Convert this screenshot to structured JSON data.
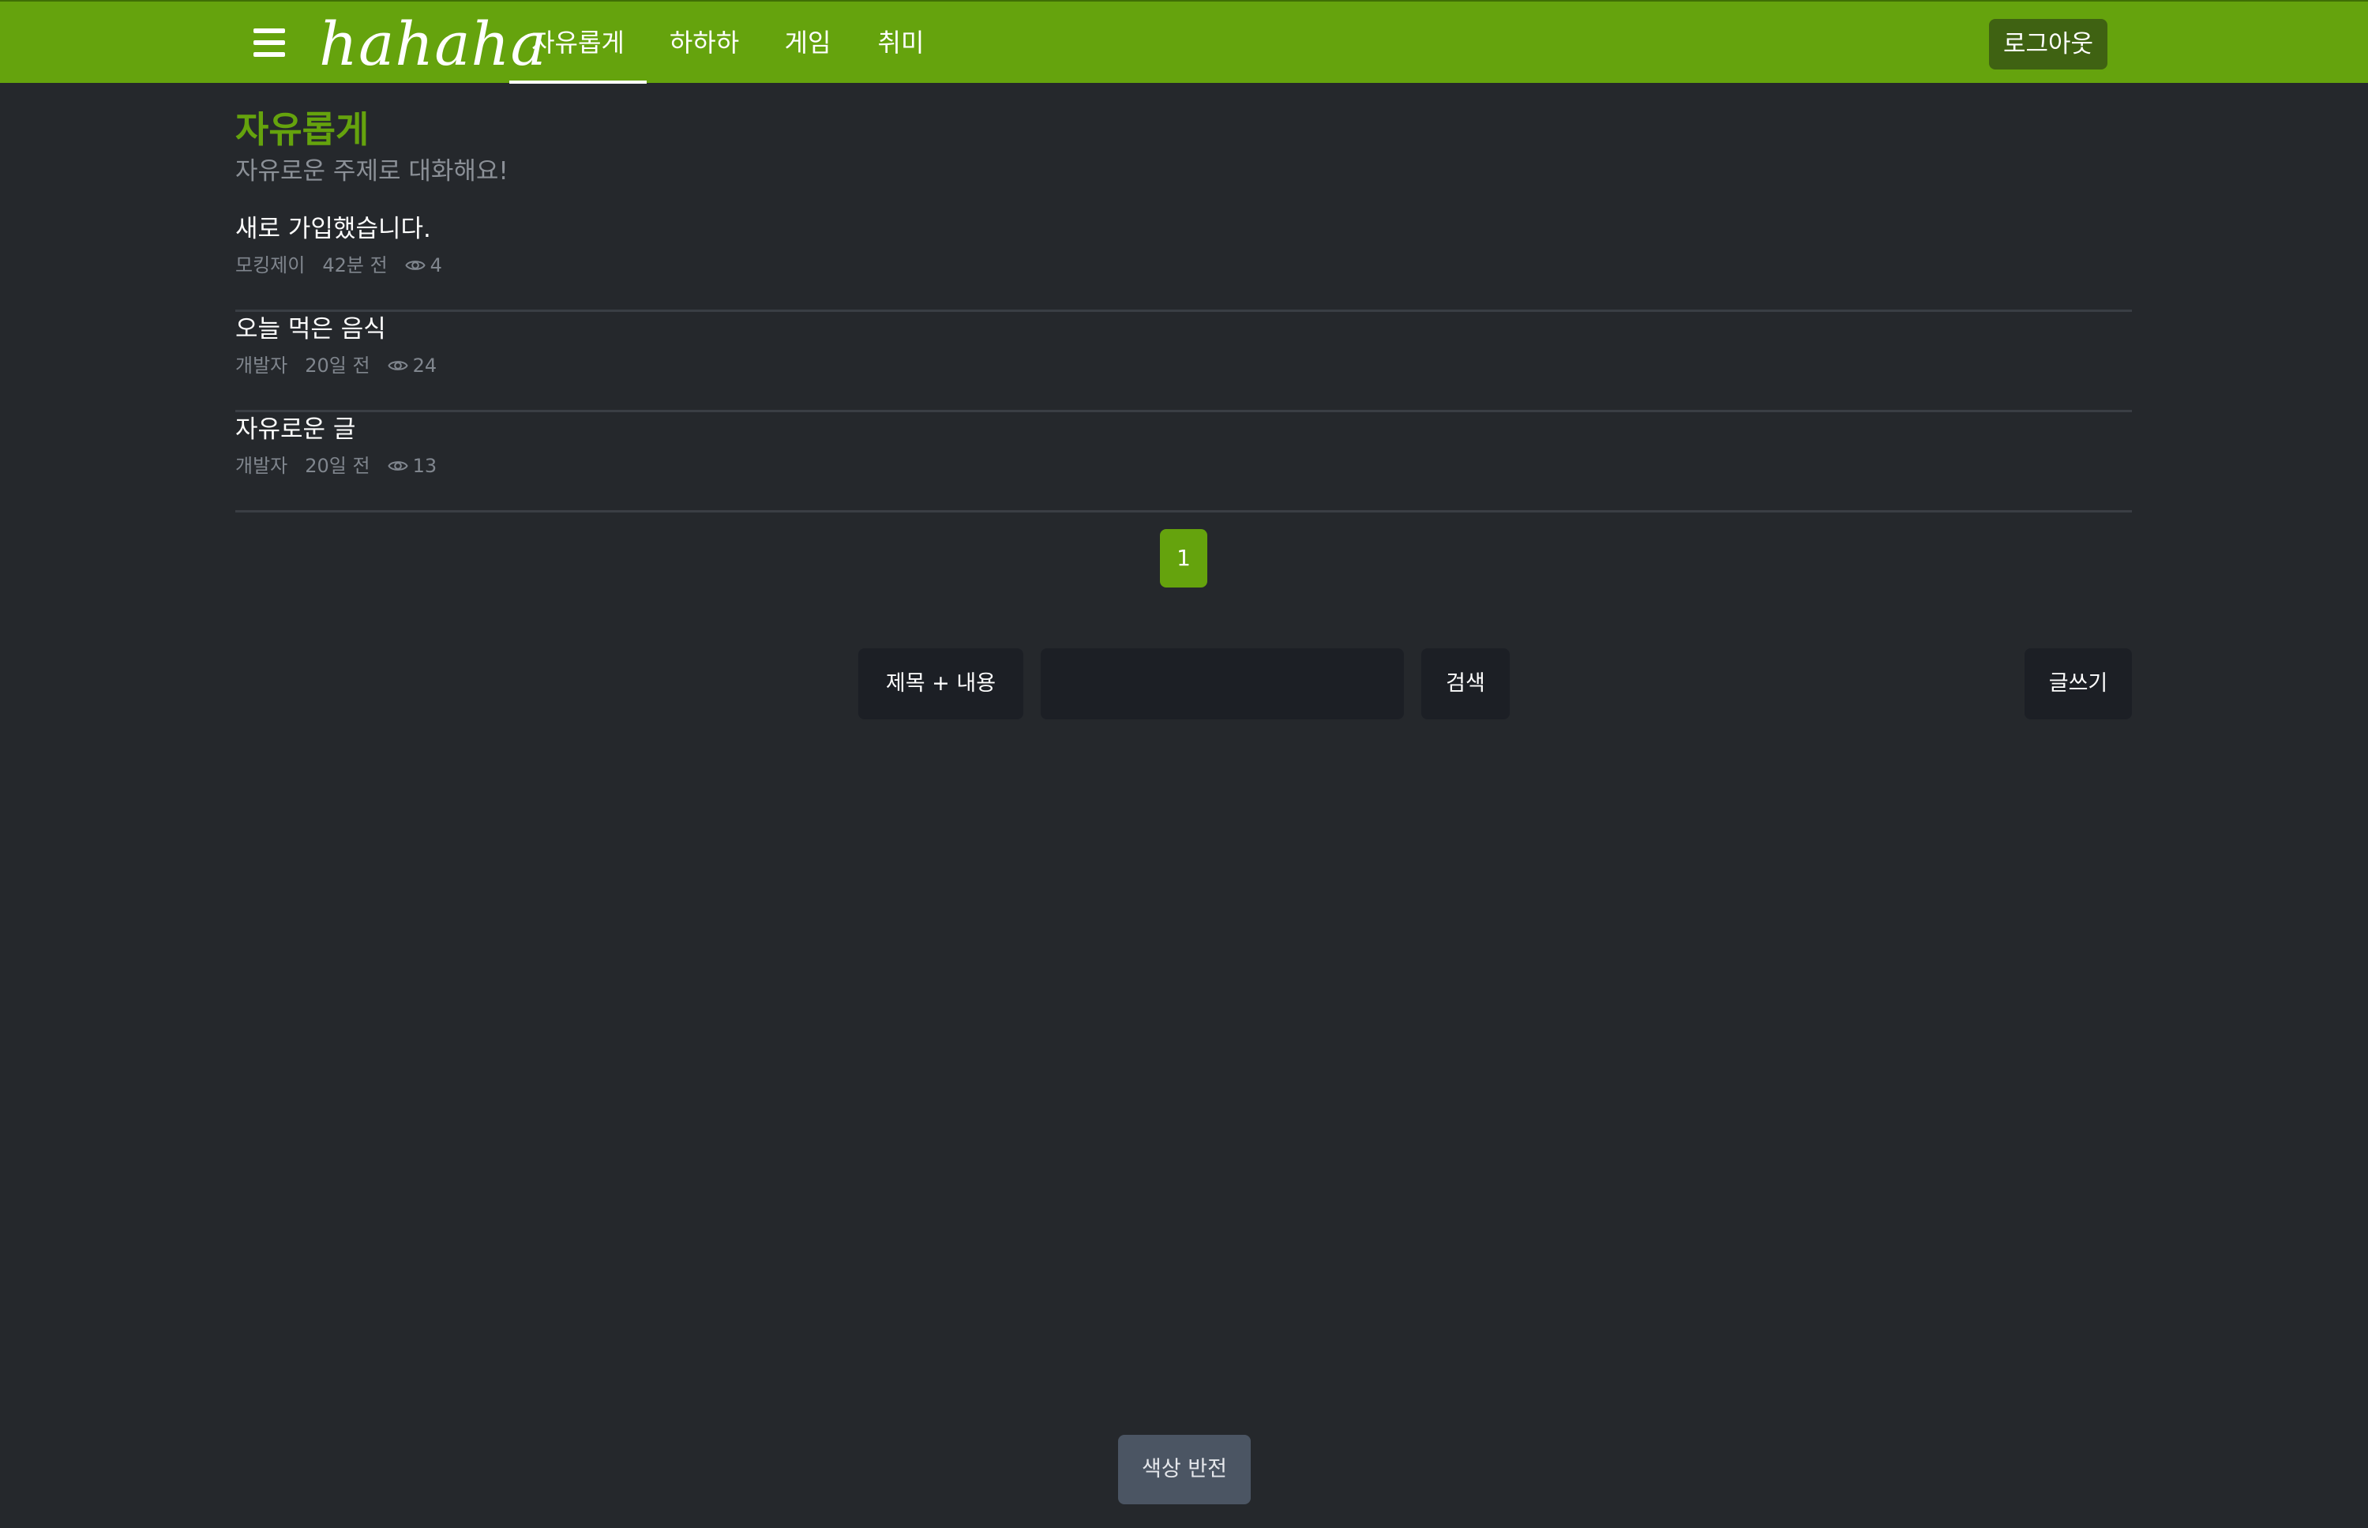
{
  "header": {
    "logo": "hahaha",
    "menu_icon": "hamburger-menu-icon",
    "tabs": [
      {
        "label": "자유롭게",
        "active": true
      },
      {
        "label": "하하하",
        "active": false
      },
      {
        "label": "게임",
        "active": false
      },
      {
        "label": "취미",
        "active": false
      }
    ],
    "logout_label": "로그아웃"
  },
  "board": {
    "title": "자유롭게",
    "description": "자유로운 주제로 대화해요!"
  },
  "posts": [
    {
      "title": "새로 가입했습니다.",
      "author": "모킹제이",
      "time": "42분 전",
      "views": "4"
    },
    {
      "title": "오늘 먹은 음식",
      "author": "개발자",
      "time": "20일 전",
      "views": "24"
    },
    {
      "title": "자유로운 글",
      "author": "개발자",
      "time": "20일 전",
      "views": "13"
    }
  ],
  "pagination": {
    "current": "1"
  },
  "search": {
    "type_label": "제목 + 내용",
    "input_value": "",
    "button_label": "검색"
  },
  "write_label": "글쓰기",
  "invert_label": "색상 반전",
  "colors": {
    "brand": "#65a30d",
    "background": "#25282c"
  }
}
